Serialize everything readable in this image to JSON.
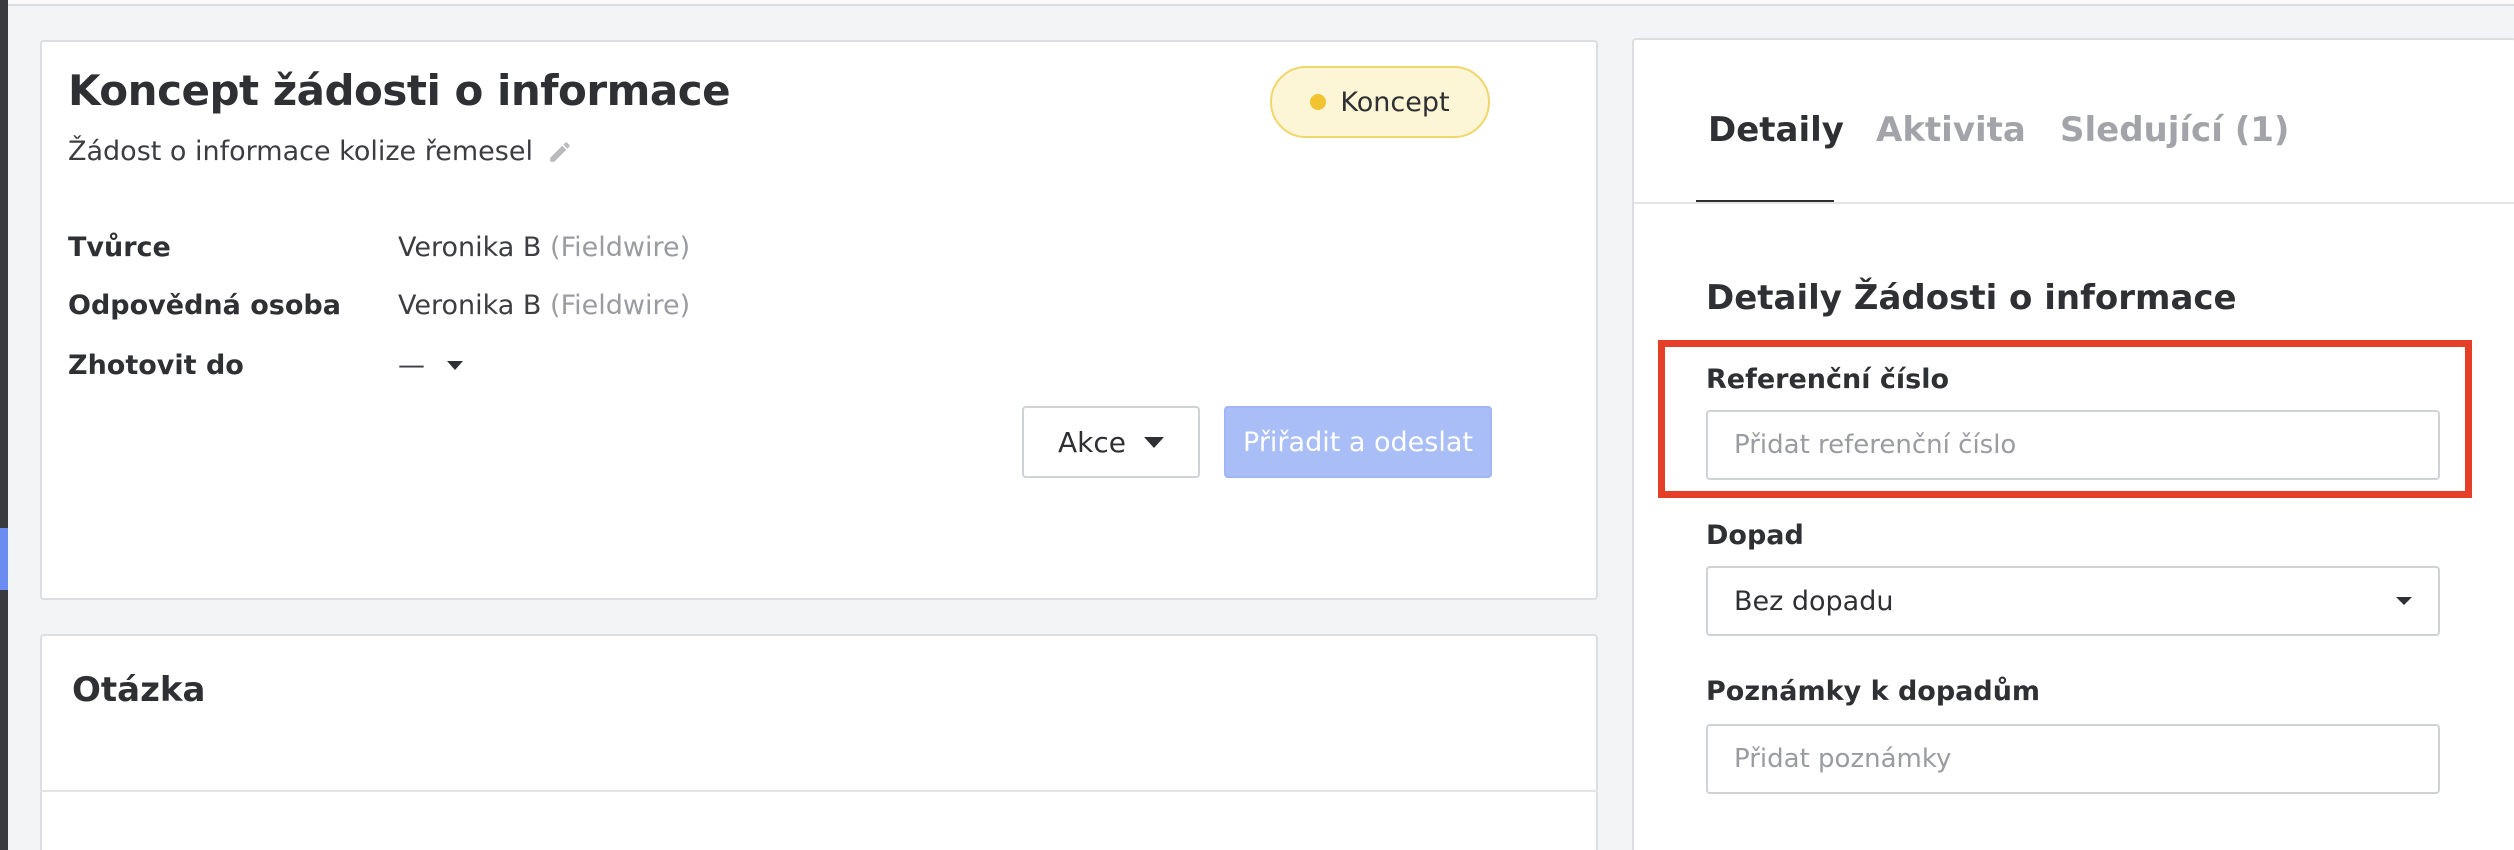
{
  "rfi": {
    "title": "Koncept žádosti o informace",
    "subtitle": "Žádost o informace kolize řemesel",
    "status": "Koncept",
    "creator_label": "Tvůrce",
    "creator_name": "Veronika B",
    "creator_org": "(Fieldwire)",
    "assignee_label": "Odpovědná osoba",
    "assignee_name": "Veronika B",
    "assignee_org": "(Fieldwire)",
    "due_label": "Zhotovit do",
    "due_value": "—",
    "actions_label": "Akce",
    "assign_send_label": "Přiřadit a odeslat"
  },
  "question": {
    "heading": "Otázka"
  },
  "sidebar": {
    "tabs": [
      {
        "label": "Detaily",
        "active": true
      },
      {
        "label": "Aktivita",
        "active": false
      },
      {
        "label": "Sledující (1)",
        "active": false
      }
    ],
    "heading": "Detaily Žádosti o informace",
    "reference_label": "Referenční číslo",
    "reference_placeholder": "Přidat referenční číslo",
    "impact_label": "Dopad",
    "impact_value": "Bez dopadu",
    "notes_label": "Poznámky k dopadům",
    "notes_placeholder": "Přidat poznámky"
  },
  "colors": {
    "highlight": "#e53f2a",
    "status_badge_bg": "#fdf6d6",
    "status_dot": "#f2c330",
    "primary_disabled": "#a9bdf7"
  },
  "icons": [
    "pencil-icon",
    "status-dot-icon",
    "caret-down-icon"
  ]
}
